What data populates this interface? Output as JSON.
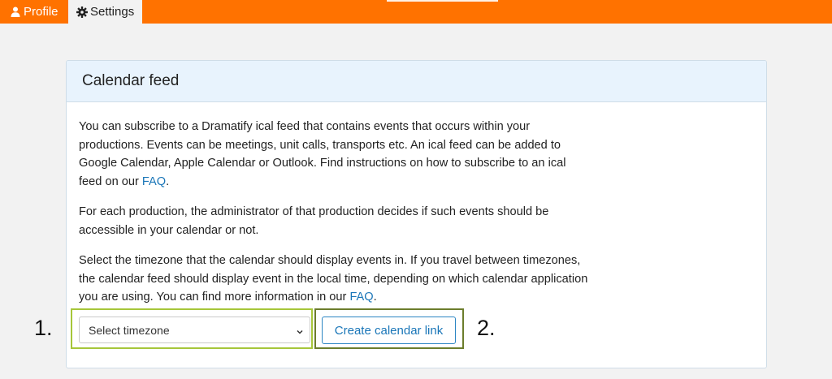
{
  "nav": {
    "tabs": [
      {
        "label": "Profile",
        "icon": "user-icon",
        "active": false
      },
      {
        "label": "Settings",
        "icon": "gear-icon",
        "active": true
      }
    ]
  },
  "card": {
    "title": "Calendar feed",
    "para1_text": "You can subscribe to a Dramatify ical feed that contains events that occurs within your productions. Events can be meetings, unit calls, transports etc. An ical feed can be added to Google Calendar, Apple Calendar or Outlook. Find instructions on how to subscribe to an ical feed on our ",
    "para1_link": "FAQ",
    "para1_end": ".",
    "para2_text": "For each production, the administrator of that production decides if such events should be accessible in your calendar or not.",
    "para3_text": "Select the timezone that the calendar should display events in. If you travel between timezones, the calendar feed should display event in the local time, depending on which calendar application you are using. You can find more information in our ",
    "para3_link": "FAQ",
    "para3_end": "."
  },
  "form": {
    "timezone_select_value": "Select timezone",
    "create_button_label": "Create calendar link"
  },
  "annotations": {
    "step1": "1.",
    "step2": "2."
  },
  "colors": {
    "brand": "#ff7200",
    "link": "#1a76b8",
    "highlight_1": "#a6c63a",
    "highlight_2": "#6c7d2c",
    "card_header_bg": "#e8f3fd"
  }
}
